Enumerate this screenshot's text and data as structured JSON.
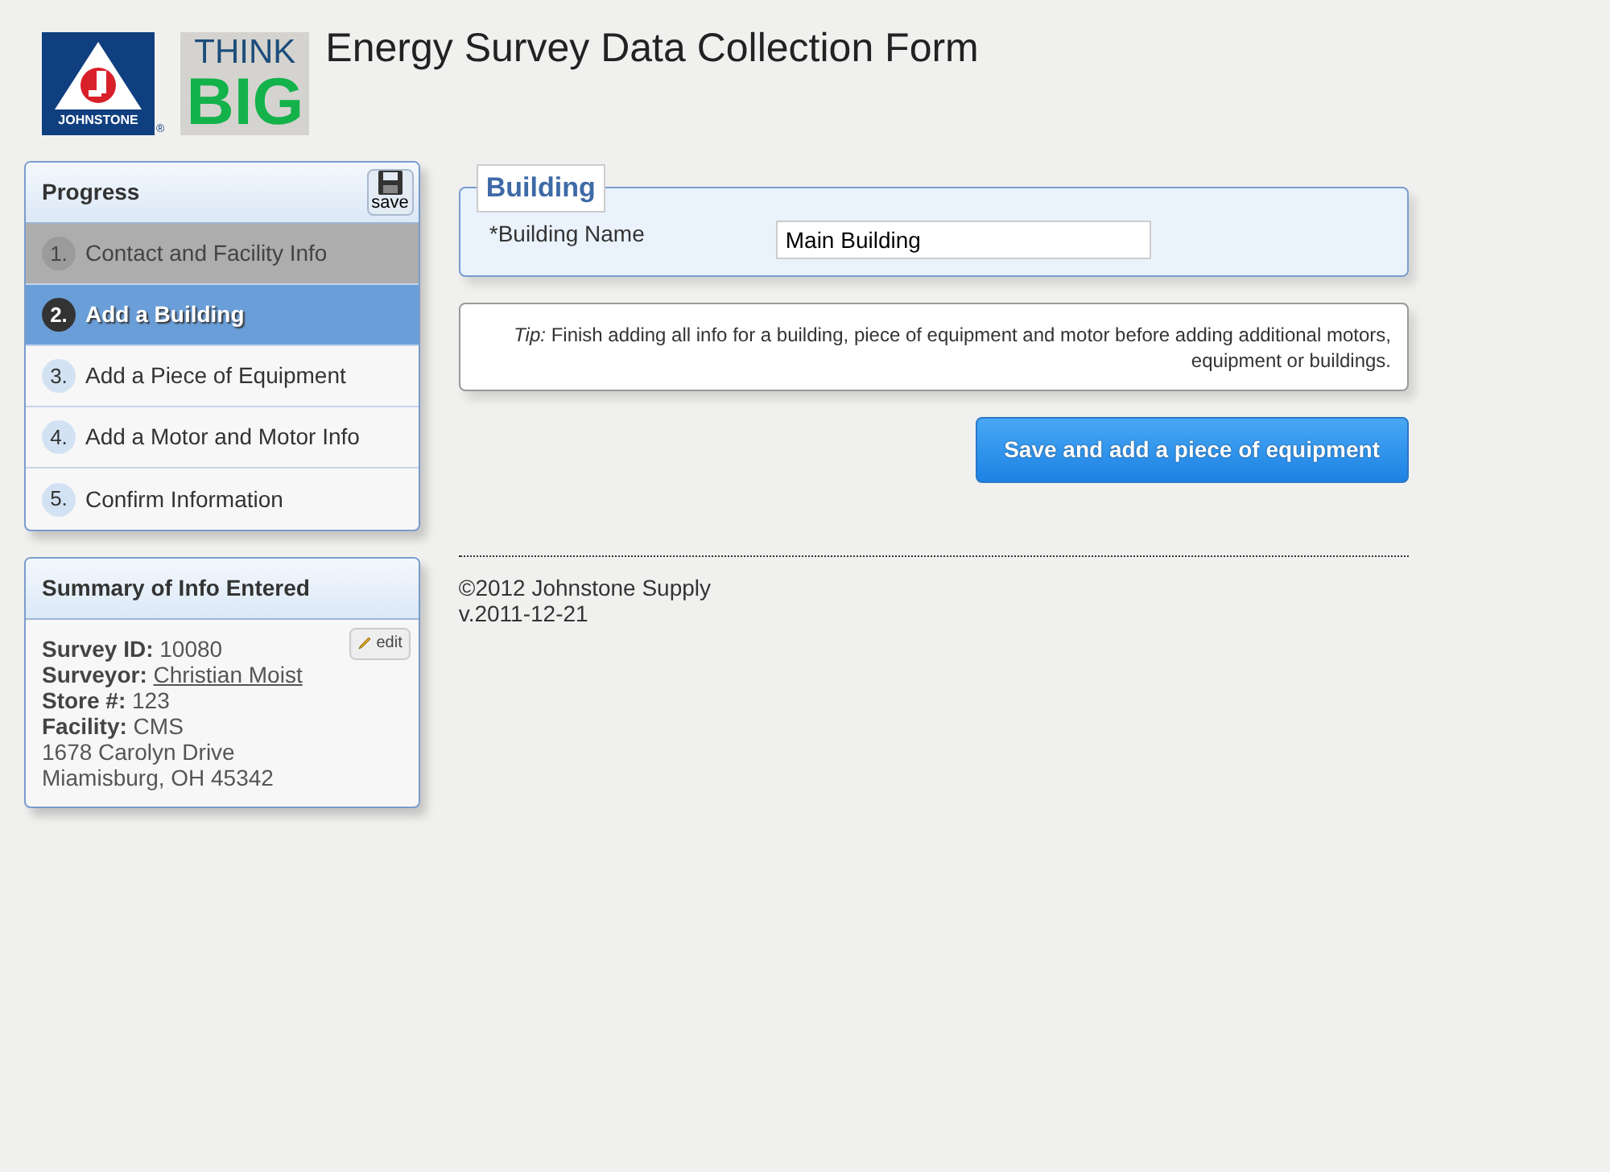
{
  "header": {
    "logo_text": "JOHNSTONE",
    "logo_mark": "®",
    "tagline_top": "THINK",
    "tagline_bottom": "BIG",
    "title": "Energy Survey Data Collection Form"
  },
  "progress": {
    "title": "Progress",
    "save_label": "save",
    "steps": [
      {
        "number": "1.",
        "label": "Contact and Facility Info",
        "completed": true,
        "selected": false
      },
      {
        "number": "2.",
        "label": "Add a Building",
        "completed": false,
        "selected": true
      },
      {
        "number": "3.",
        "label": "Add a Piece of Equipment",
        "completed": false,
        "selected": false
      },
      {
        "number": "4.",
        "label": "Add a Motor and Motor Info",
        "completed": false,
        "selected": false
      },
      {
        "number": "5.",
        "label": "Confirm Information",
        "completed": false,
        "selected": false
      }
    ]
  },
  "summary": {
    "title": "Summary of Info Entered",
    "edit_label": "edit",
    "fields": [
      {
        "label": "Survey ID:",
        "value": "10080",
        "kind": "text"
      },
      {
        "label": "Surveyor:",
        "value": "Christian Moist",
        "kind": "link"
      },
      {
        "label": "Store #:",
        "value": "123",
        "kind": "text"
      },
      {
        "label": "Facility:",
        "value": "CMS",
        "kind": "text"
      }
    ],
    "address": [
      "1678 Carolyn Drive",
      "Miamisburg, OH 45342"
    ]
  },
  "building": {
    "legend": "Building",
    "field_label": "*Building Name",
    "field_value": "Main Building"
  },
  "tip": {
    "lead": "Tip:",
    "text": "Finish adding all info for a building, piece of equipment and motor before adding additional motors, equipment or buildings."
  },
  "submit_label": "Save and add a piece of equipment",
  "footer": {
    "copyright": "©2012 Johnstone Supply",
    "version": "v.2011-12-21"
  }
}
